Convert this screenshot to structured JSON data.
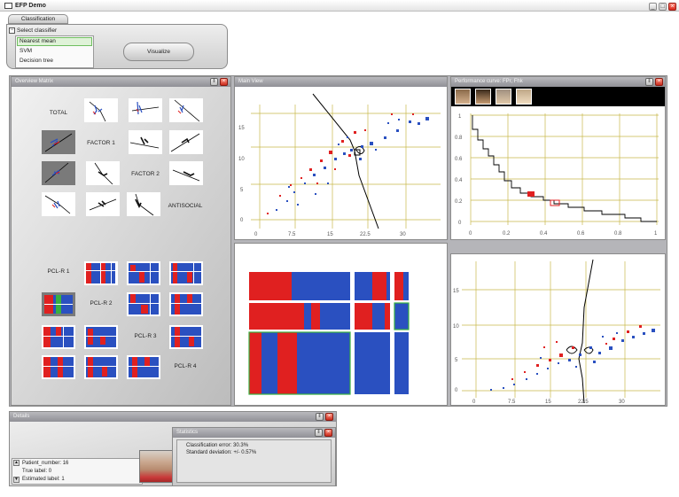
{
  "app": {
    "title": "EFP Demo",
    "controls": {
      "minimize": "_",
      "maximize": "□",
      "close": "×"
    }
  },
  "tabs": [
    {
      "label": "Classification"
    }
  ],
  "classifier": {
    "header": "Select classifier",
    "options": [
      "Nearest mean",
      "SVM",
      "Decision tree"
    ],
    "selected": "Nearest mean",
    "visualize_label": "Visualize"
  },
  "overview": {
    "title": "Overview Matrix",
    "factor_labels": [
      "TOTAL",
      "FACTOR 1",
      "FACTOR 2",
      "ANTISOCIAL"
    ],
    "pcl_labels": [
      "PCL-R 1",
      "PCL-R 2",
      "PCL-R 3",
      "PCL-R 4"
    ]
  },
  "main_view": {
    "title": "Main View",
    "x_ticks": [
      "0",
      "7.5",
      "15",
      "22.5",
      "30"
    ],
    "y_ticks": [
      "15",
      "10",
      "5",
      "0"
    ]
  },
  "performance": {
    "title": "Performance curve: FPr, Fhk",
    "x_ticks": [
      "0",
      "0.2",
      "0.4",
      "0.6",
      "0.8",
      "1"
    ],
    "y_ticks": [
      "1",
      "0.8",
      "0.6",
      "0.4",
      "0.2",
      "0"
    ]
  },
  "lower_plot": {
    "x_ticks": [
      "0",
      "7.5",
      "15",
      "22.5",
      "30"
    ],
    "y_ticks": [
      "15",
      "10",
      "5",
      "0"
    ]
  },
  "details": {
    "title": "Details",
    "fields": [
      "Patient_number: 16",
      "True label: 0",
      "Estimated label: 1"
    ]
  },
  "statistics": {
    "title": "Statistics",
    "lines": [
      "Classification error: 30.3%",
      "Standard deviation: +/- 0.57%"
    ]
  },
  "colors": {
    "class_red": "#e02020",
    "class_blue": "#2a50c0",
    "highlight_green": "#37b040",
    "grid_yellow": "#c8b84a",
    "panel_gray": "#b8b8bc"
  }
}
